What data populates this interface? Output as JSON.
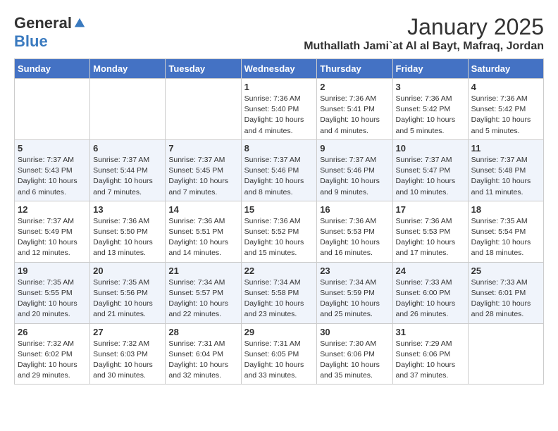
{
  "header": {
    "logo_general": "General",
    "logo_blue": "Blue",
    "month_title": "January 2025",
    "location": "Muthallath Jami`at Al al Bayt, Mafraq, Jordan"
  },
  "weekdays": [
    "Sunday",
    "Monday",
    "Tuesday",
    "Wednesday",
    "Thursday",
    "Friday",
    "Saturday"
  ],
  "weeks": [
    [
      {
        "day": "",
        "info": ""
      },
      {
        "day": "",
        "info": ""
      },
      {
        "day": "",
        "info": ""
      },
      {
        "day": "1",
        "info": "Sunrise: 7:36 AM\nSunset: 5:40 PM\nDaylight: 10 hours and 4 minutes."
      },
      {
        "day": "2",
        "info": "Sunrise: 7:36 AM\nSunset: 5:41 PM\nDaylight: 10 hours and 4 minutes."
      },
      {
        "day": "3",
        "info": "Sunrise: 7:36 AM\nSunset: 5:42 PM\nDaylight: 10 hours and 5 minutes."
      },
      {
        "day": "4",
        "info": "Sunrise: 7:36 AM\nSunset: 5:42 PM\nDaylight: 10 hours and 5 minutes."
      }
    ],
    [
      {
        "day": "5",
        "info": "Sunrise: 7:37 AM\nSunset: 5:43 PM\nDaylight: 10 hours and 6 minutes."
      },
      {
        "day": "6",
        "info": "Sunrise: 7:37 AM\nSunset: 5:44 PM\nDaylight: 10 hours and 7 minutes."
      },
      {
        "day": "7",
        "info": "Sunrise: 7:37 AM\nSunset: 5:45 PM\nDaylight: 10 hours and 7 minutes."
      },
      {
        "day": "8",
        "info": "Sunrise: 7:37 AM\nSunset: 5:46 PM\nDaylight: 10 hours and 8 minutes."
      },
      {
        "day": "9",
        "info": "Sunrise: 7:37 AM\nSunset: 5:46 PM\nDaylight: 10 hours and 9 minutes."
      },
      {
        "day": "10",
        "info": "Sunrise: 7:37 AM\nSunset: 5:47 PM\nDaylight: 10 hours and 10 minutes."
      },
      {
        "day": "11",
        "info": "Sunrise: 7:37 AM\nSunset: 5:48 PM\nDaylight: 10 hours and 11 minutes."
      }
    ],
    [
      {
        "day": "12",
        "info": "Sunrise: 7:37 AM\nSunset: 5:49 PM\nDaylight: 10 hours and 12 minutes."
      },
      {
        "day": "13",
        "info": "Sunrise: 7:36 AM\nSunset: 5:50 PM\nDaylight: 10 hours and 13 minutes."
      },
      {
        "day": "14",
        "info": "Sunrise: 7:36 AM\nSunset: 5:51 PM\nDaylight: 10 hours and 14 minutes."
      },
      {
        "day": "15",
        "info": "Sunrise: 7:36 AM\nSunset: 5:52 PM\nDaylight: 10 hours and 15 minutes."
      },
      {
        "day": "16",
        "info": "Sunrise: 7:36 AM\nSunset: 5:53 PM\nDaylight: 10 hours and 16 minutes."
      },
      {
        "day": "17",
        "info": "Sunrise: 7:36 AM\nSunset: 5:53 PM\nDaylight: 10 hours and 17 minutes."
      },
      {
        "day": "18",
        "info": "Sunrise: 7:35 AM\nSunset: 5:54 PM\nDaylight: 10 hours and 18 minutes."
      }
    ],
    [
      {
        "day": "19",
        "info": "Sunrise: 7:35 AM\nSunset: 5:55 PM\nDaylight: 10 hours and 20 minutes."
      },
      {
        "day": "20",
        "info": "Sunrise: 7:35 AM\nSunset: 5:56 PM\nDaylight: 10 hours and 21 minutes."
      },
      {
        "day": "21",
        "info": "Sunrise: 7:34 AM\nSunset: 5:57 PM\nDaylight: 10 hours and 22 minutes."
      },
      {
        "day": "22",
        "info": "Sunrise: 7:34 AM\nSunset: 5:58 PM\nDaylight: 10 hours and 23 minutes."
      },
      {
        "day": "23",
        "info": "Sunrise: 7:34 AM\nSunset: 5:59 PM\nDaylight: 10 hours and 25 minutes."
      },
      {
        "day": "24",
        "info": "Sunrise: 7:33 AM\nSunset: 6:00 PM\nDaylight: 10 hours and 26 minutes."
      },
      {
        "day": "25",
        "info": "Sunrise: 7:33 AM\nSunset: 6:01 PM\nDaylight: 10 hours and 28 minutes."
      }
    ],
    [
      {
        "day": "26",
        "info": "Sunrise: 7:32 AM\nSunset: 6:02 PM\nDaylight: 10 hours and 29 minutes."
      },
      {
        "day": "27",
        "info": "Sunrise: 7:32 AM\nSunset: 6:03 PM\nDaylight: 10 hours and 30 minutes."
      },
      {
        "day": "28",
        "info": "Sunrise: 7:31 AM\nSunset: 6:04 PM\nDaylight: 10 hours and 32 minutes."
      },
      {
        "day": "29",
        "info": "Sunrise: 7:31 AM\nSunset: 6:05 PM\nDaylight: 10 hours and 33 minutes."
      },
      {
        "day": "30",
        "info": "Sunrise: 7:30 AM\nSunset: 6:06 PM\nDaylight: 10 hours and 35 minutes."
      },
      {
        "day": "31",
        "info": "Sunrise: 7:29 AM\nSunset: 6:06 PM\nDaylight: 10 hours and 37 minutes."
      },
      {
        "day": "",
        "info": ""
      }
    ]
  ]
}
